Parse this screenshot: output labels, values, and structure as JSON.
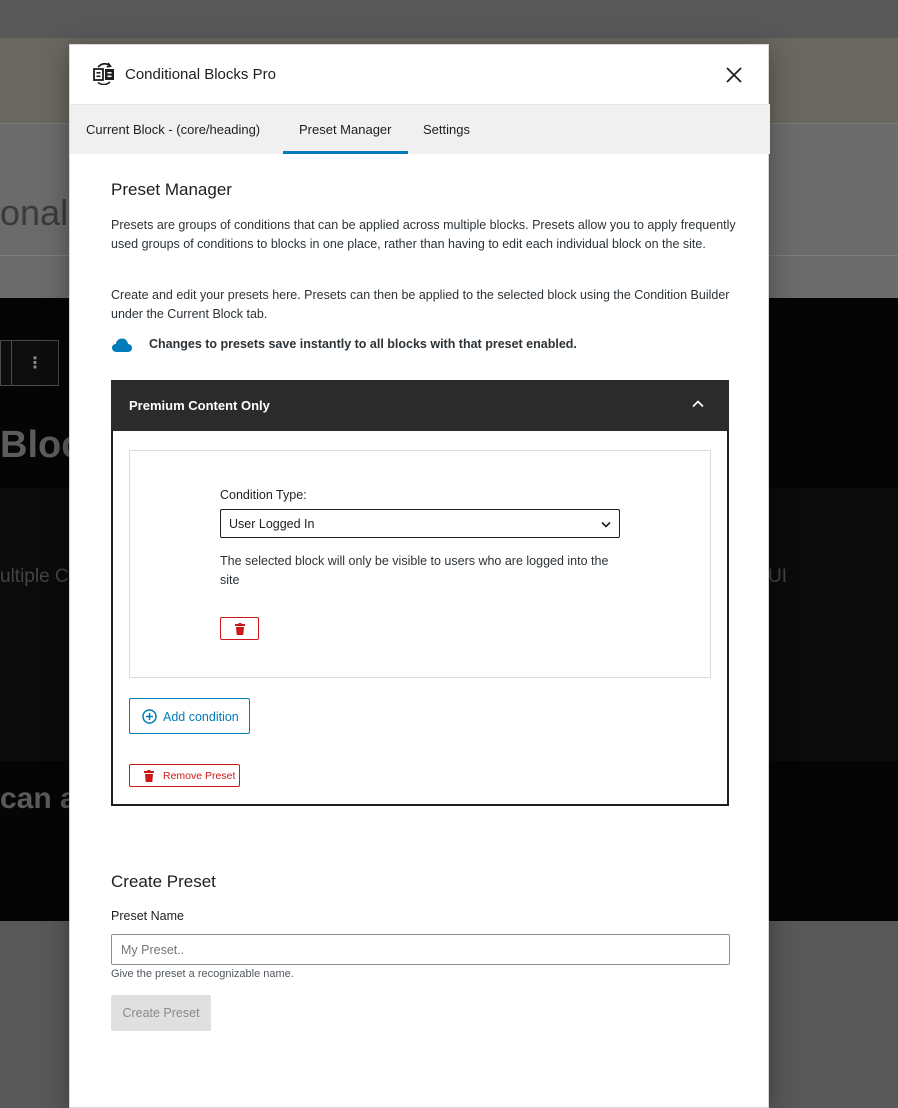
{
  "background": {
    "heading_fragment": "onal",
    "block_title_fragment": "Bloc",
    "paragraph_fragment": "ultiple C",
    "paragraph_end_fragment": "UI",
    "heading2_fragment": "can ap",
    "toolbar_more": "⋮"
  },
  "modal": {
    "title": "Conditional Blocks Pro",
    "close_icon": "close-icon"
  },
  "tabs": [
    {
      "label": "Current Block - (core/heading)",
      "active": false
    },
    {
      "label": "Preset Manager",
      "active": true
    },
    {
      "label": "Settings",
      "active": false
    }
  ],
  "preset_manager": {
    "heading": "Preset Manager",
    "intro": "Presets are groups of conditions that can be applied across multiple blocks. Presets allow you to apply frequently used groups of conditions to blocks in one place, rather than having to edit each individual block on the site.",
    "instructions": "Create and edit your presets here. Presets can then be applied to the selected block using the Condition Builder under the Current Block tab.",
    "notice": "Changes to presets save instantly to all blocks with that preset enabled."
  },
  "preset": {
    "title": "Premium Content Only",
    "condition": {
      "type_label": "Condition Type:",
      "type_value": "User Logged In",
      "description": "The selected block will only be visible to users who are logged into the site"
    },
    "add_condition_label": "Add condition",
    "remove_preset_label": "Remove Preset"
  },
  "create_preset": {
    "heading": "Create Preset",
    "name_label": "Preset Name",
    "name_value": "",
    "name_placeholder": "My Preset..",
    "help": "Give the preset a recognizable name.",
    "button_label": "Create Preset"
  },
  "colors": {
    "accent": "#007cba",
    "danger": "#cc1818",
    "panel_header": "#2b2b2b"
  }
}
